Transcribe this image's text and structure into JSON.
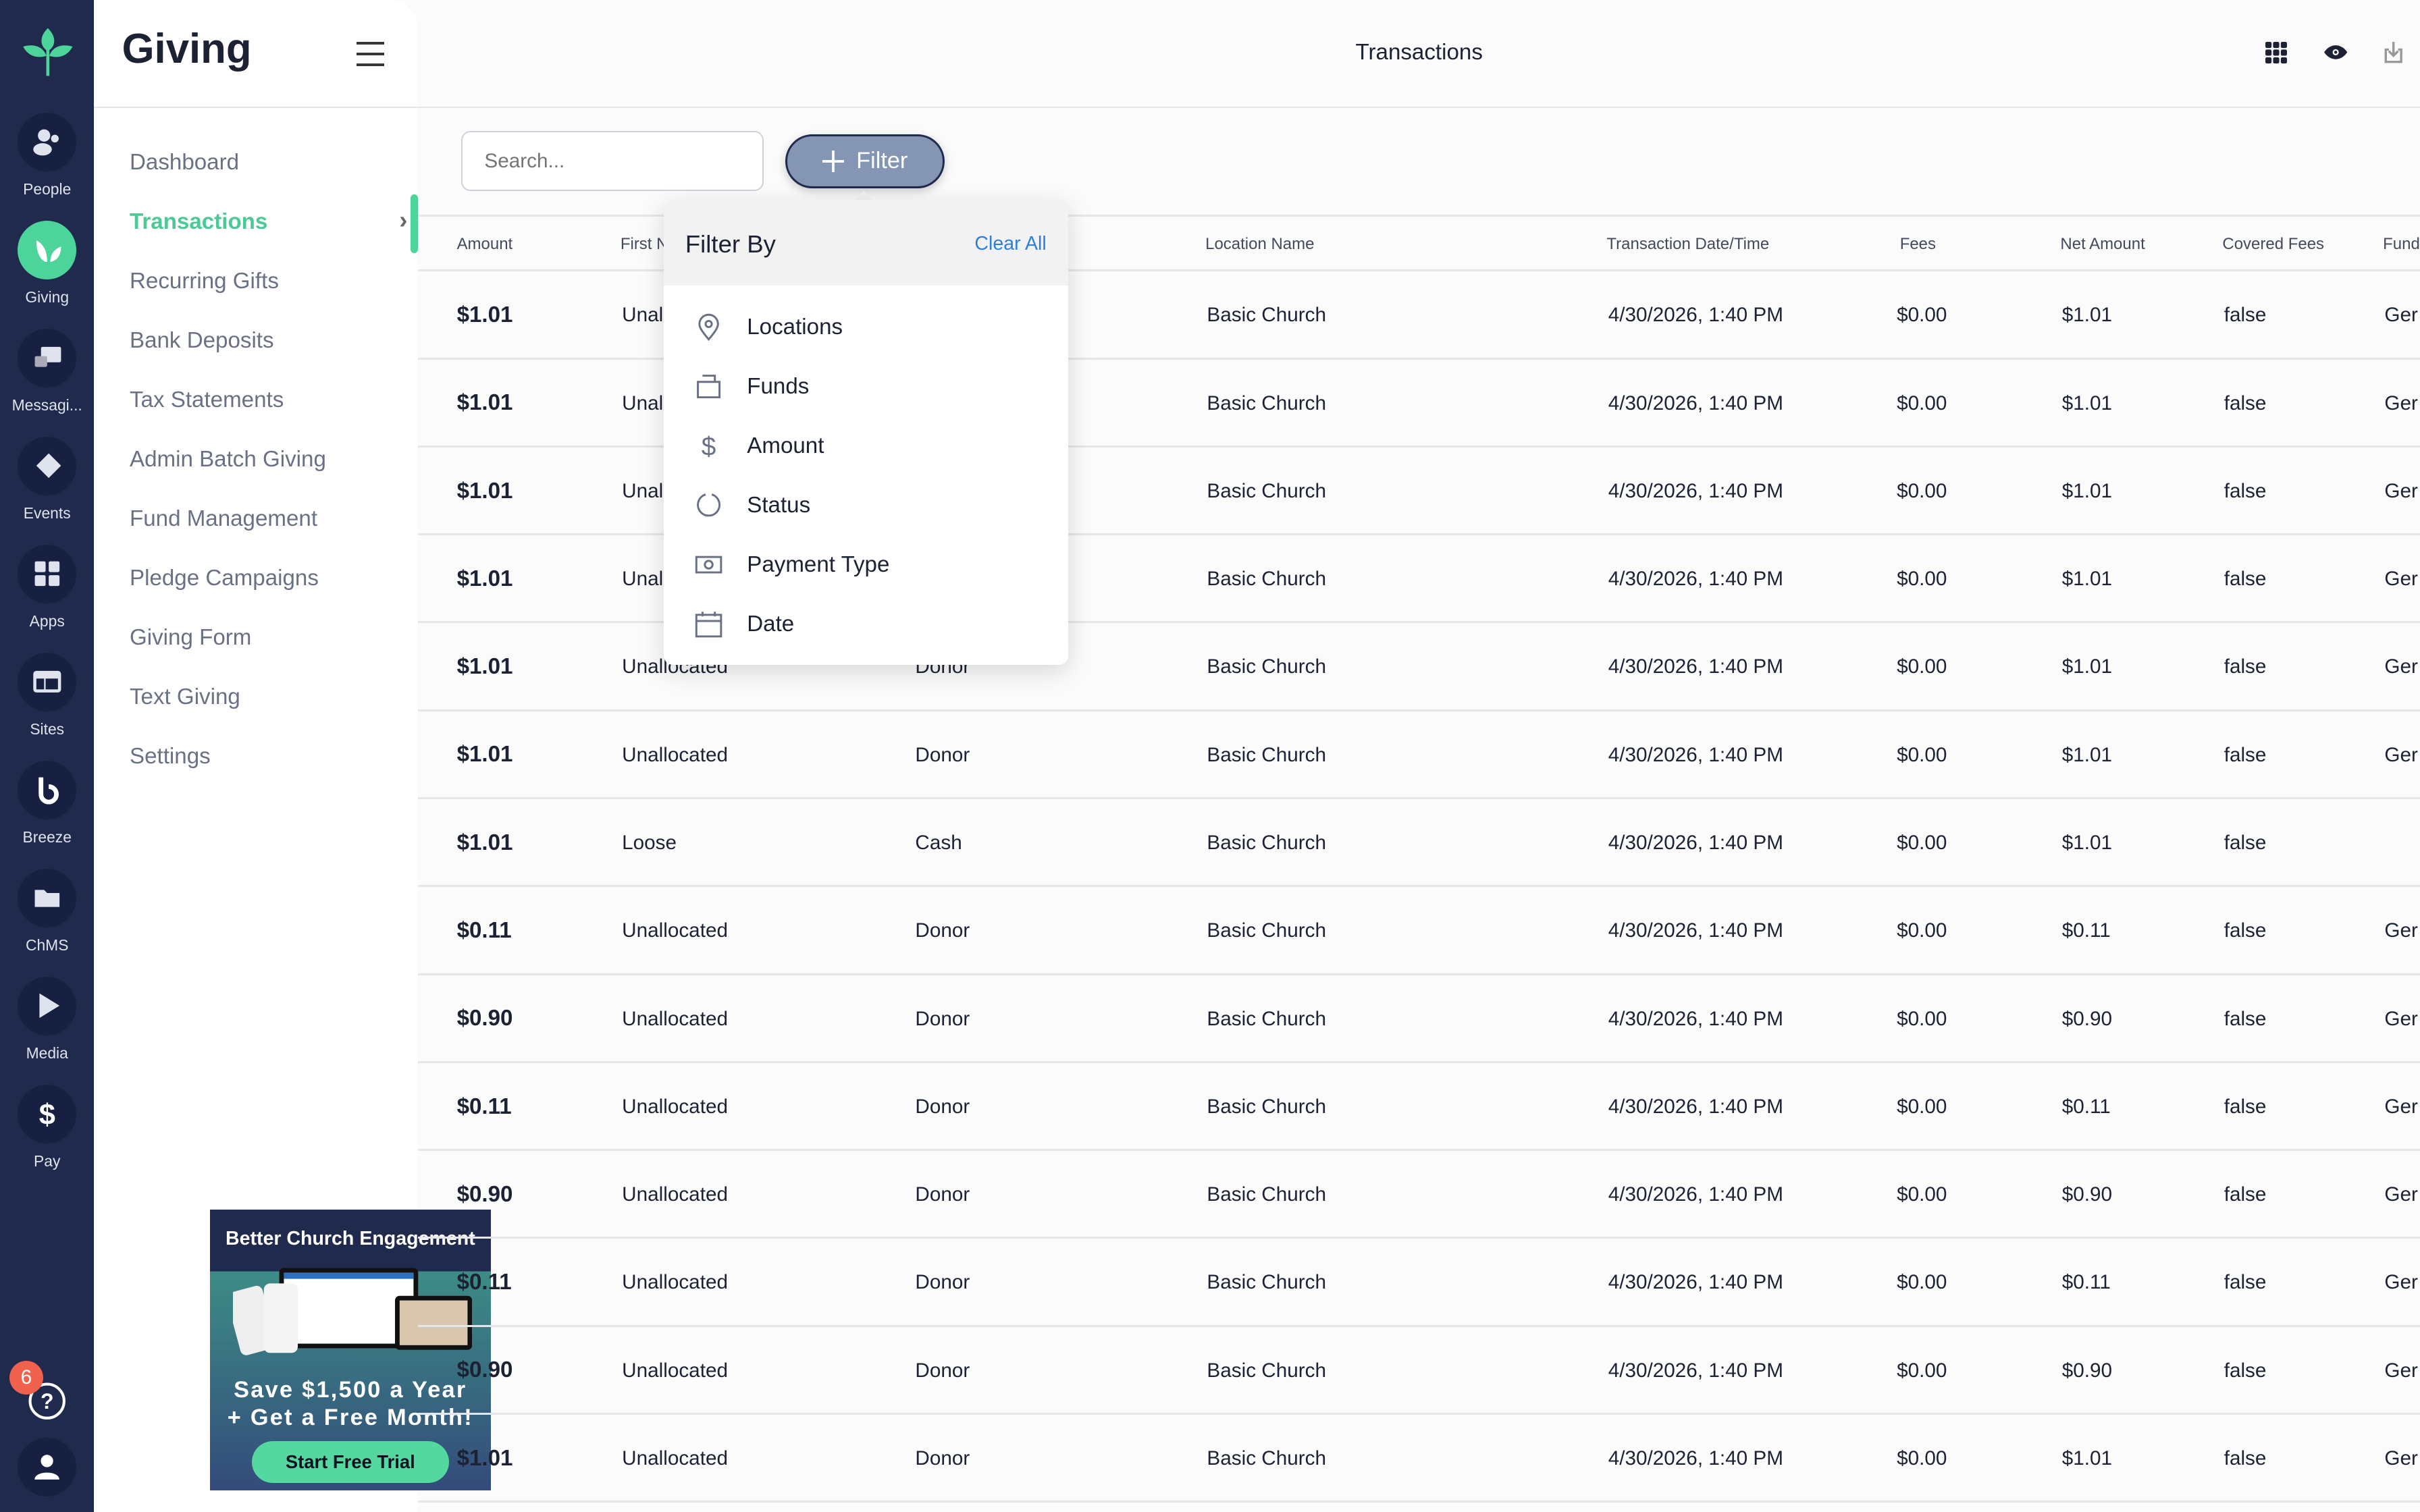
{
  "rail": {
    "items": [
      {
        "label": "People",
        "icon": "people-icon"
      },
      {
        "label": "Giving",
        "icon": "leaf-icon",
        "active": true
      },
      {
        "label": "Messagi...",
        "icon": "chat-icon"
      },
      {
        "label": "Events",
        "icon": "ticket-icon"
      },
      {
        "label": "Apps",
        "icon": "apps-icon"
      },
      {
        "label": "Sites",
        "icon": "layout-icon"
      },
      {
        "label": "Breeze",
        "icon": "breeze-icon"
      },
      {
        "label": "ChMS",
        "icon": "folder-icon"
      },
      {
        "label": "Media",
        "icon": "play-icon"
      },
      {
        "label": "Pay",
        "icon": "dollar-icon"
      }
    ],
    "help_badge": "6"
  },
  "sidebar": {
    "title": "Giving",
    "items": [
      "Dashboard",
      "Transactions",
      "Recurring Gifts",
      "Bank Deposits",
      "Tax Statements",
      "Admin Batch Giving",
      "Fund Management",
      "Pledge Campaigns",
      "Giving Form",
      "Text Giving",
      "Settings"
    ],
    "active": "Transactions"
  },
  "promo": {
    "title": "Better Church Engagement",
    "line1": "Save $1,500 a Year",
    "line2": "+ Get a Free Month!",
    "button": "Start Free Trial"
  },
  "header": {
    "title": "Transactions",
    "icons": [
      "grid-icon",
      "eye-icon",
      "export-icon"
    ]
  },
  "search": {
    "placeholder": "Search..."
  },
  "filter_button": "Filter",
  "filter_menu": {
    "title": "Filter By",
    "clear": "Clear All",
    "items": [
      {
        "label": "Locations",
        "icon": "location-pin-icon"
      },
      {
        "label": "Funds",
        "icon": "funds-icon"
      },
      {
        "label": "Amount",
        "icon": "dollar-icon"
      },
      {
        "label": "Status",
        "icon": "status-circle-icon"
      },
      {
        "label": "Payment Type",
        "icon": "cash-icon"
      },
      {
        "label": "Date",
        "icon": "calendar-icon"
      }
    ]
  },
  "table": {
    "columns": [
      "Amount",
      "First N",
      "",
      "Location Name",
      "Transaction Date/Time",
      "Fees",
      "Net Amount",
      "Covered Fees",
      "Fund"
    ],
    "rows": [
      [
        "$1.01",
        "Unal",
        "",
        "Basic Church",
        "4/30/2026, 1:40 PM",
        "$0.00",
        "$1.01",
        "false",
        "Ger"
      ],
      [
        "$1.01",
        "Unal",
        "",
        "Basic Church",
        "4/30/2026, 1:40 PM",
        "$0.00",
        "$1.01",
        "false",
        "Ger"
      ],
      [
        "$1.01",
        "Unal",
        "",
        "Basic Church",
        "4/30/2026, 1:40 PM",
        "$0.00",
        "$1.01",
        "false",
        "Ger"
      ],
      [
        "$1.01",
        "Unal",
        "",
        "Basic Church",
        "4/30/2026, 1:40 PM",
        "$0.00",
        "$1.01",
        "false",
        "Ger"
      ],
      [
        "$1.01",
        "Unallocated",
        "Donor",
        "Basic Church",
        "4/30/2026, 1:40 PM",
        "$0.00",
        "$1.01",
        "false",
        "Ger"
      ],
      [
        "$1.01",
        "Unallocated",
        "Donor",
        "Basic Church",
        "4/30/2026, 1:40 PM",
        "$0.00",
        "$1.01",
        "false",
        "Ger"
      ],
      [
        "$1.01",
        "Loose",
        "Cash",
        "Basic Church",
        "4/30/2026, 1:40 PM",
        "$0.00",
        "$1.01",
        "false",
        ""
      ],
      [
        "$0.11",
        "Unallocated",
        "Donor",
        "Basic Church",
        "4/30/2026, 1:40 PM",
        "$0.00",
        "$0.11",
        "false",
        "Ger"
      ],
      [
        "$0.90",
        "Unallocated",
        "Donor",
        "Basic Church",
        "4/30/2026, 1:40 PM",
        "$0.00",
        "$0.90",
        "false",
        "Ger"
      ],
      [
        "$0.11",
        "Unallocated",
        "Donor",
        "Basic Church",
        "4/30/2026, 1:40 PM",
        "$0.00",
        "$0.11",
        "false",
        "Ger"
      ],
      [
        "$0.90",
        "Unallocated",
        "Donor",
        "Basic Church",
        "4/30/2026, 1:40 PM",
        "$0.00",
        "$0.90",
        "false",
        "Ger"
      ],
      [
        "$0.11",
        "Unallocated",
        "Donor",
        "Basic Church",
        "4/30/2026, 1:40 PM",
        "$0.00",
        "$0.11",
        "false",
        "Ger"
      ],
      [
        "$0.90",
        "Unallocated",
        "Donor",
        "Basic Church",
        "4/30/2026, 1:40 PM",
        "$0.00",
        "$0.90",
        "false",
        "Ger"
      ],
      [
        "$1.01",
        "Unallocated",
        "Donor",
        "Basic Church",
        "4/30/2026, 1:40 PM",
        "$0.00",
        "$1.01",
        "false",
        "Ger"
      ]
    ]
  },
  "colors": {
    "rail": "#1f2a4d",
    "accent": "#4cd49b",
    "link": "#2f7fd6",
    "filter": "#8595b4",
    "badge": "#f0624d"
  }
}
